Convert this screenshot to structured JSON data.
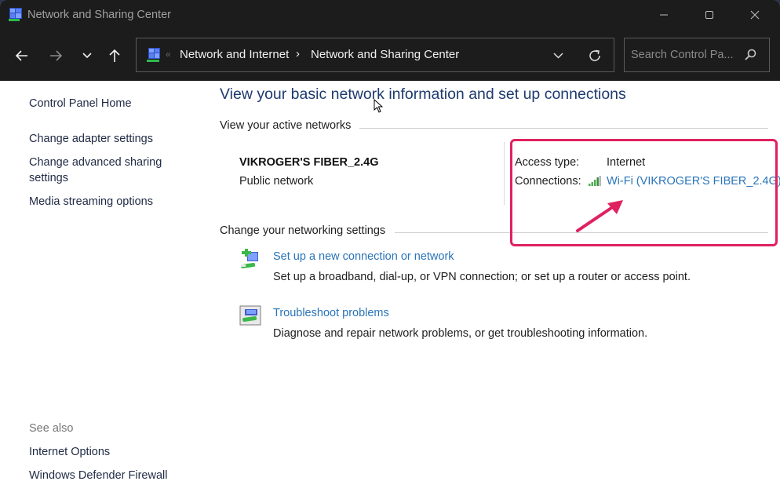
{
  "window": {
    "title": "Network and Sharing Center",
    "controls": {
      "minimize": "minimize",
      "maximize": "maximize",
      "close": "close"
    }
  },
  "toolbar": {
    "nav": {
      "back": "Back",
      "forward": "Forward",
      "recent": "Recent locations",
      "up": "Up"
    },
    "breadcrumb": {
      "overflow": "«",
      "items": [
        "Network and Internet",
        "Network and Sharing Center"
      ],
      "separator": "›"
    },
    "search": {
      "placeholder": "Search Control Pa..."
    }
  },
  "sidebar": {
    "items": [
      {
        "label": "Control Panel Home"
      },
      {
        "label": "Change adapter settings"
      },
      {
        "label": "Change advanced sharing settings"
      },
      {
        "label": "Media streaming options"
      }
    ],
    "see_also": {
      "heading": "See also",
      "items": [
        {
          "label": "Internet Options"
        },
        {
          "label": "Windows Defender Firewall"
        }
      ]
    }
  },
  "main": {
    "title": "View your basic network information and set up connections",
    "active_networks": {
      "heading": "View your active networks",
      "network": {
        "name": "VIKROGER'S FIBER_2.4G",
        "category": "Public network",
        "access_type_label": "Access type:",
        "access_type_value": "Internet",
        "connections_label": "Connections:",
        "connection_link": "Wi-Fi (VIKROGER'S FIBER_2.4G)",
        "signal_icon": "wifi-signal-icon"
      }
    },
    "change_settings": {
      "heading": "Change your networking settings",
      "tasks": [
        {
          "icon": "new-connection-icon",
          "link": "Set up a new connection or network",
          "description": "Set up a broadband, dial-up, or VPN connection; or set up a router or access point."
        },
        {
          "icon": "troubleshoot-icon",
          "link": "Troubleshoot problems",
          "description": "Diagnose and repair network problems, or get troubleshooting information."
        }
      ]
    }
  },
  "annotation": {
    "highlight_color": "#e0215f"
  },
  "colors": {
    "link": "#2a74b8",
    "title": "#1e3a6e",
    "titlebar": "#1c1c1c"
  }
}
